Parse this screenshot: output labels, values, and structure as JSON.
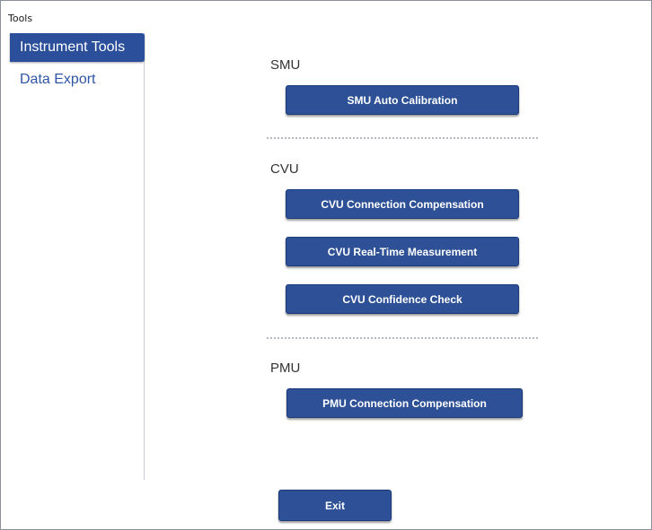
{
  "window": {
    "title": "Tools"
  },
  "sidebar": {
    "items": [
      {
        "label": "Instrument Tools",
        "active": true
      },
      {
        "label": "Data Export",
        "active": false
      }
    ]
  },
  "sections": {
    "smu": {
      "label": "SMU",
      "buttons": [
        "SMU Auto Calibration"
      ]
    },
    "cvu": {
      "label": "CVU",
      "buttons": [
        "CVU Connection Compensation",
        "CVU Real-Time Measurement",
        "CVU Confidence Check"
      ]
    },
    "pmu": {
      "label": "PMU",
      "buttons": [
        "PMU Connection Compensation"
      ]
    }
  },
  "footer": {
    "exit_label": "Exit"
  },
  "colors": {
    "accent": "#2d5096",
    "sidebar_active": "#2b4f9b",
    "link_text": "#2f55a6"
  }
}
